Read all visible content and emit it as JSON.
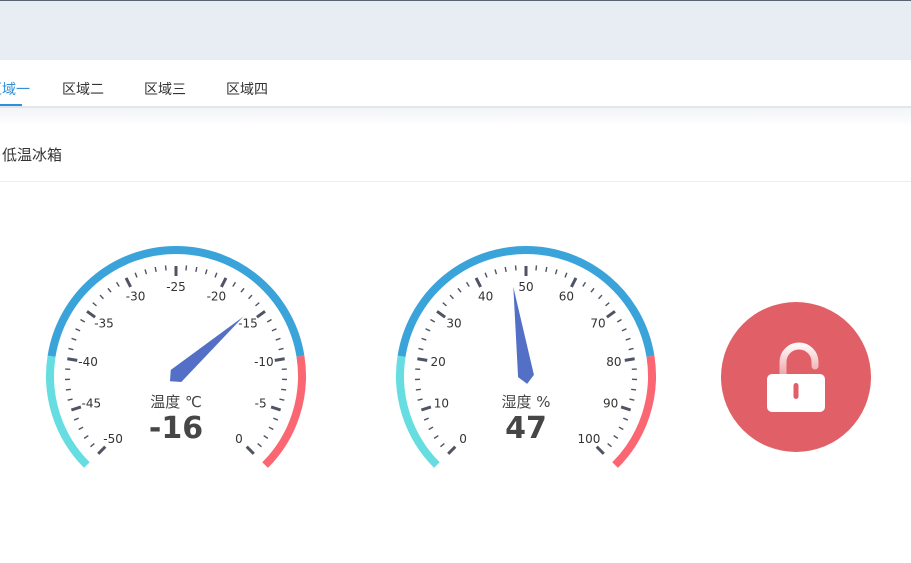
{
  "tabs": [
    "区域一",
    "区域二",
    "区域三",
    "区域四"
  ],
  "panel": {
    "title": "低温冰箱"
  },
  "gauges": [
    {
      "label": "温度 ℃",
      "value": -16,
      "display_value": "-16",
      "min": -50,
      "max": 0,
      "tick_labels": [
        "-50",
        "-45",
        "-40",
        "-35",
        "-30",
        "-25",
        "-20",
        "-15",
        "-10",
        "-5",
        "0"
      ],
      "band_colors": [
        "#66dde0",
        "#3aa3da",
        "#fa6772"
      ]
    },
    {
      "label": "湿度 %",
      "value": 47,
      "display_value": "47",
      "min": 0,
      "max": 100,
      "tick_labels": [
        "0",
        "10",
        "20",
        "30",
        "40",
        "50",
        "60",
        "70",
        "80",
        "90",
        "100"
      ],
      "band_colors": [
        "#66dde0",
        "#3aa3da",
        "#fa6772"
      ]
    }
  ],
  "lock": {
    "state": "unlocked",
    "icon": "unlock-icon",
    "color": "#e15f66"
  }
}
